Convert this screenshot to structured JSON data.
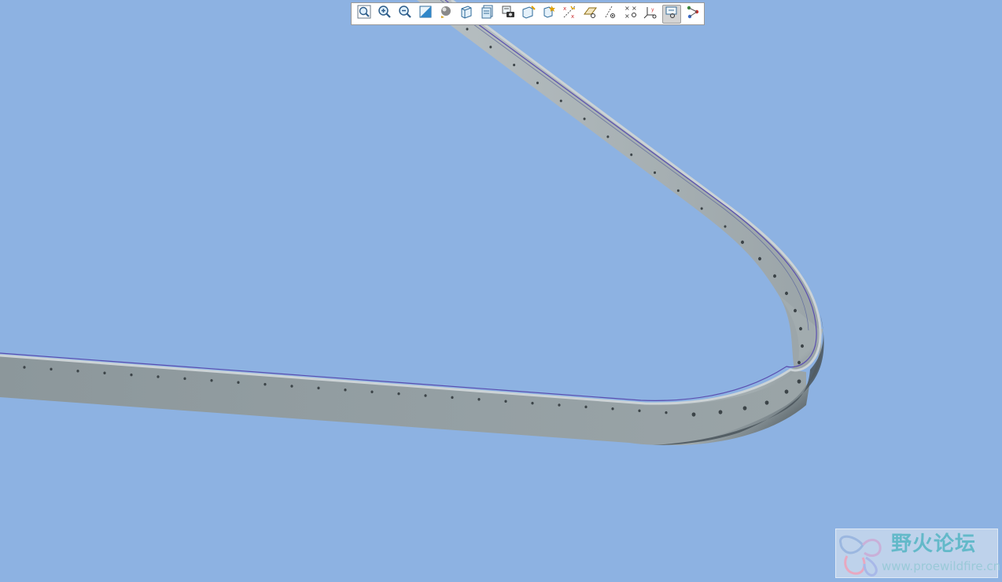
{
  "colors": {
    "background": "#8db2e2",
    "strip_light": "#a4aeb1",
    "strip_mid": "#8b979c",
    "strip_dark": "#3e474c",
    "edge_line": "#5a4fb0",
    "hole": "#3c4448",
    "watermark_text": "#63b9c9",
    "watermark_url": "#9ac9d8"
  },
  "toolbar": {
    "buttons": [
      {
        "name": "refit-button",
        "icon": "zoom-fit-icon",
        "active": false
      },
      {
        "name": "zoom-in-button",
        "icon": "zoom-in-icon",
        "active": false
      },
      {
        "name": "zoom-out-button",
        "icon": "zoom-out-icon",
        "active": false
      },
      {
        "name": "repaint-button",
        "icon": "repaint-icon",
        "active": false
      },
      {
        "name": "display-style-button",
        "icon": "shading-sphere-icon",
        "active": false
      },
      {
        "name": "saved-orientations-button",
        "icon": "view-cube-icon",
        "active": false
      },
      {
        "name": "view-manager-button",
        "icon": "view-manager-icon",
        "active": false
      },
      {
        "name": "perspective-view-button",
        "icon": "camera-icon",
        "active": false
      },
      {
        "name": "section-button",
        "icon": "section-cube-icon",
        "active": false
      },
      {
        "name": "spin-center-button",
        "icon": "spin-center-icon",
        "active": false
      },
      {
        "name": "datum-display-button",
        "icon": "datum-display-icon",
        "active": false
      },
      {
        "name": "plane-display-button",
        "icon": "datum-plane-icon",
        "active": false
      },
      {
        "name": "axis-display-button",
        "icon": "datum-axis-icon",
        "active": false
      },
      {
        "name": "point-display-button",
        "icon": "datum-point-icon",
        "active": false
      },
      {
        "name": "csys-display-button",
        "icon": "csys-icon",
        "active": false
      },
      {
        "name": "annotation-display-button",
        "icon": "annotation-display-icon",
        "active": true
      },
      {
        "name": "network-display-button",
        "icon": "network-icon",
        "active": false
      }
    ]
  },
  "watermark": {
    "title": "野火论坛",
    "url": "www.proewildfire.cn"
  }
}
